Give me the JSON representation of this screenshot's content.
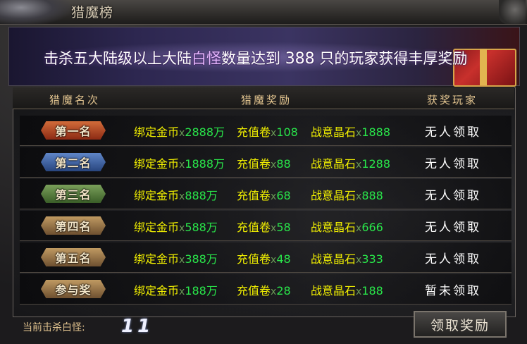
{
  "window": {
    "title": "猎魔榜"
  },
  "banner": {
    "text_prefix": "击杀五大陆级以上大陆",
    "highlight": "白怪",
    "text_mid": "数量达到 ",
    "count": "388",
    "text_suffix": " 只的玩家获得丰厚奖励"
  },
  "table": {
    "headers": {
      "rank": "猎魔名次",
      "reward": "猎魔奖励",
      "winner": "获奖玩家"
    },
    "rows": [
      {
        "rank": "第一名",
        "gold_label": "绑定金币",
        "gold_x": "x",
        "gold": "2888万",
        "card_label": "充值卷",
        "card_x": "x",
        "card": "108",
        "crystal_label": "战意晶石",
        "crystal_x": "x",
        "crystal": "1888",
        "winner": "无人领取"
      },
      {
        "rank": "第二名",
        "gold_label": "绑定金币",
        "gold_x": "x",
        "gold": "1888万",
        "card_label": "充值卷",
        "card_x": "x",
        "card": "88",
        "crystal_label": "战意晶石",
        "crystal_x": "x",
        "crystal": "1288",
        "winner": "无人领取"
      },
      {
        "rank": "第三名",
        "gold_label": "绑定金币",
        "gold_x": "x",
        "gold": "888万",
        "card_label": "充值卷",
        "card_x": "x",
        "card": "68",
        "crystal_label": "战意晶石",
        "crystal_x": "x",
        "crystal": "888",
        "winner": "无人领取"
      },
      {
        "rank": "第四名",
        "gold_label": "绑定金币",
        "gold_x": "x",
        "gold": "588万",
        "card_label": "充值卷",
        "card_x": "x",
        "card": "58",
        "crystal_label": "战意晶石",
        "crystal_x": "x",
        "crystal": "666",
        "winner": "无人领取"
      },
      {
        "rank": "第五名",
        "gold_label": "绑定金币",
        "gold_x": "x",
        "gold": "388万",
        "card_label": "充值卷",
        "card_x": "x",
        "card": "48",
        "crystal_label": "战意晶石",
        "crystal_x": "x",
        "crystal": "333",
        "winner": "无人领取"
      },
      {
        "rank": "参与奖",
        "gold_label": "绑定金币",
        "gold_x": "x",
        "gold": "188万",
        "card_label": "充值卷",
        "card_x": "x",
        "card": "28",
        "crystal_label": "战意晶石",
        "crystal_x": "x",
        "crystal": "188",
        "winner": "暂未领取"
      }
    ]
  },
  "footer": {
    "kill_label": "当前击杀白怪:",
    "kill_count": "11",
    "claim_button": "领取奖励"
  },
  "colors": {
    "reward_name": "#f2f000",
    "reward_value": "#29e64a",
    "header_text": "#e3c590",
    "rank1": "#d26c3a",
    "rank2": "#5f86c8",
    "rank3": "#7aa05a",
    "rank_default": "#c09a62"
  }
}
